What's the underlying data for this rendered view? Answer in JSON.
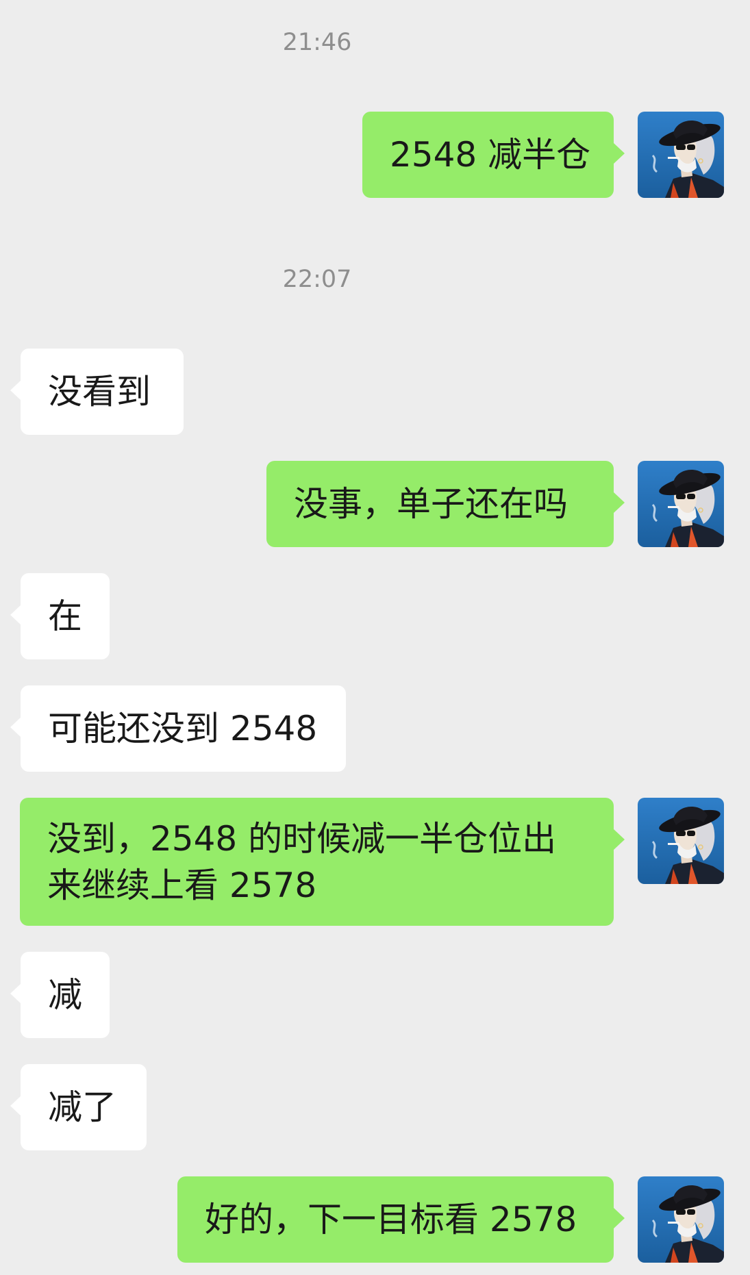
{
  "chat": {
    "timestamps": [
      "21:46",
      "22:07"
    ],
    "messages": [
      {
        "from": "me",
        "text": "2548 减半仓"
      },
      {
        "from": "other",
        "text": "没看到"
      },
      {
        "from": "me",
        "text": "没事，单子还在吗"
      },
      {
        "from": "other",
        "text": "在"
      },
      {
        "from": "other",
        "text": "可能还没到 2548"
      },
      {
        "from": "me",
        "text": "没到，2548 的时候减一半仓位出来继续上看 2578"
      },
      {
        "from": "other",
        "text": "减"
      },
      {
        "from": "other",
        "text": "减了"
      },
      {
        "from": "me",
        "text": "好的，下一目标看 2578"
      }
    ]
  },
  "colors": {
    "background": "#ededed",
    "outgoing_bubble": "#95ec69",
    "incoming_bubble": "#ffffff",
    "timestamp_text": "#8e8e8e"
  },
  "icons": {
    "avatar": "user-avatar-icon"
  }
}
